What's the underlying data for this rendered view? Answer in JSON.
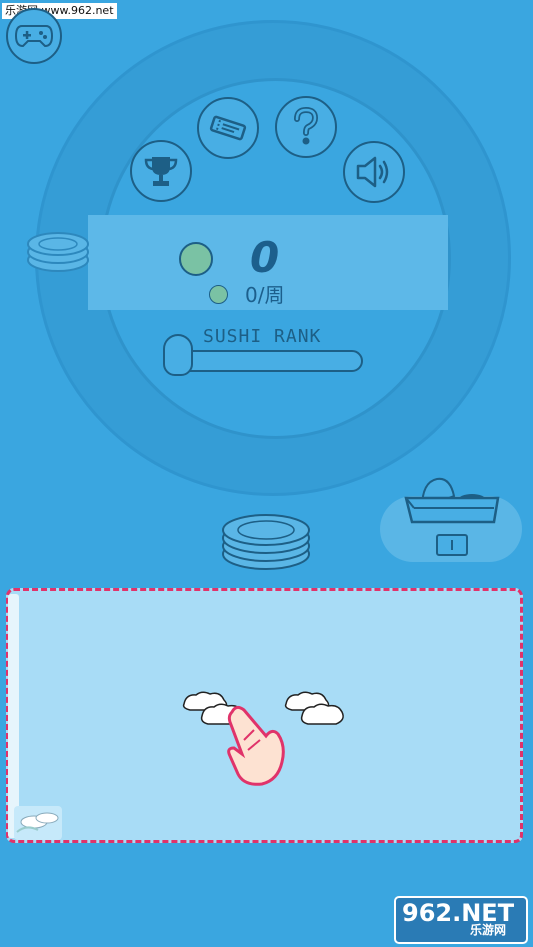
{
  "watermark": {
    "top_text": "乐游网 www.962.net",
    "logo_main": "962.NET",
    "logo_sub": "乐游网"
  },
  "score": {
    "coins": "0",
    "per_week": "0/周"
  },
  "rank": {
    "label": "SUSHI RANK",
    "progress": 0
  },
  "buttons": {
    "gamepad": "gamepad-icon",
    "trophy": "trophy-icon",
    "ticket": "ticket-icon",
    "help": "question-icon",
    "sound": "speaker-icon"
  },
  "colors": {
    "background": "#3aa6e0",
    "play_area": "#a8dcf6",
    "dashed_border": "#e0336a",
    "outline": "#1d5f86"
  }
}
